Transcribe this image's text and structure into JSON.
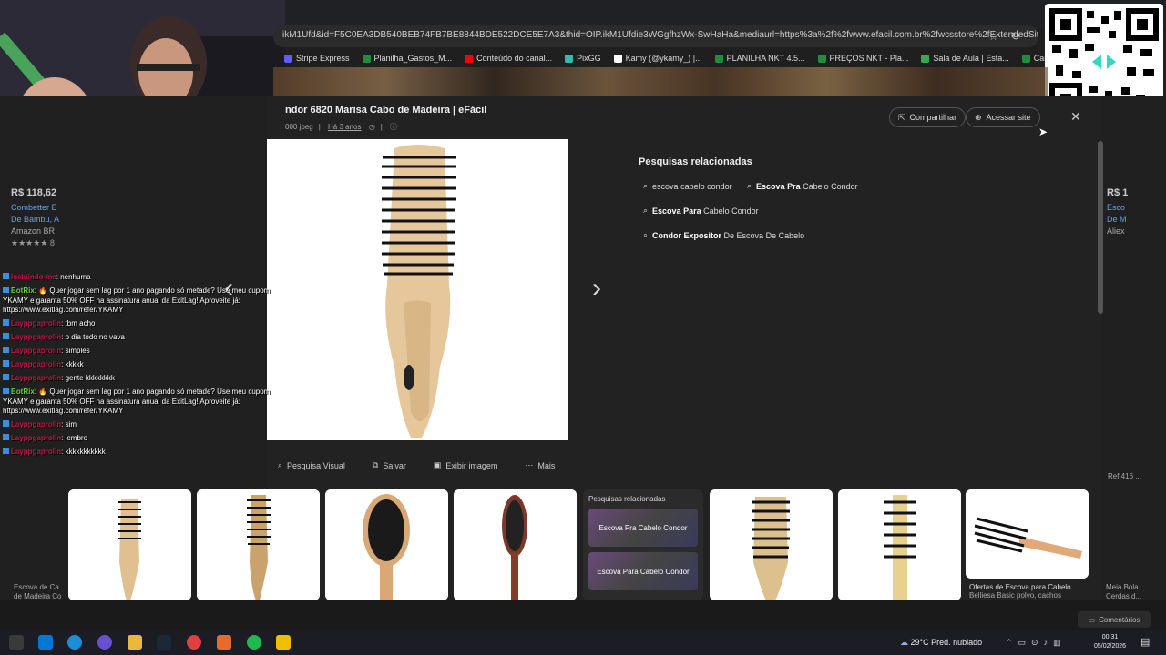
{
  "browser": {
    "url": "ikM1Ufd&id=F5C0EA3DB540BEB74FB7BE8844BDE522DCE5E7A3&thid=OIP.ikM1Ufdie3WGgfhzWx-SwHaHa&mediaurl=https%3a%2f%2fwww.efacil.com.br%2fwcsstore%2fExtendedSit...",
    "bookmarks": [
      {
        "label": "Stripe Express",
        "color": "#635bff"
      },
      {
        "label": "Planilha_Gastos_M...",
        "color": "#1e8e3e"
      },
      {
        "label": "Conteúdo do canal...",
        "color": "#ff0000"
      },
      {
        "label": "PixGG",
        "color": "#32bcad"
      },
      {
        "label": "Kamy (@ykamy_) |...",
        "color": "#ffffff"
      },
      {
        "label": "PLANILHA NKT 4.5...",
        "color": "#1e8e3e"
      },
      {
        "label": "PREÇOS NKT - Pla...",
        "color": "#1e8e3e"
      },
      {
        "label": "Sala de Aula | Esta...",
        "color": "#34a853"
      },
      {
        "label": "Cargos Ninjas - Pla...",
        "color": "#1e8e3e"
      }
    ]
  },
  "panel": {
    "title": "ndor 6820 Marisa Cabo de Madeira | eFácil",
    "meta_size": "000 jpeg",
    "meta_time": "Há 3 anos",
    "share_label": "Compartilhar",
    "visit_label": "Acessar site",
    "related_title": "Pesquisas relacionadas",
    "related": [
      {
        "pre": "",
        "bold": "",
        "post": "escova cabelo condor"
      },
      {
        "pre": "",
        "bold": "Escova Pra",
        "post": " Cabelo Condor"
      },
      {
        "pre": "",
        "bold": "Escova Para",
        "post": " Cabelo Condor"
      },
      {
        "pre": "",
        "bold": "Condor Expositor",
        "post": " De Escova De Cabelo"
      }
    ],
    "actions": [
      "Pesquisa Visual",
      "Salvar",
      "Exibir imagem",
      "Mais"
    ]
  },
  "left_card": {
    "price": "R$ 118,62",
    "line1": "Combetter E",
    "line2": "De Bambu, A",
    "store": "Amazon BR",
    "rating": "★★★★★ 8"
  },
  "right_card": {
    "price": "R$ 1",
    "line1": "Esco",
    "line2": "De M",
    "store": "Aliex"
  },
  "thumbs": {
    "related_title": "Pesquisas relacionadas",
    "related_1": "Escova Pra Cabelo Condor",
    "related_2": "Escova Para Cabelo Condor",
    "caption_1": "Ofertas de Escova para Cabelo",
    "caption_2": "Belliesa Basic polvo, cachos",
    "left_caption_1": "Escova de Ca",
    "left_caption_2": "de Madeira Co",
    "right_caption_1": "Meia Bola",
    "right_caption_2": "Cerdas d...",
    "right_ref": "Ref 416 ..."
  },
  "chat": [
    {
      "user": "Incluindo-me",
      "msg": ": nenhuma",
      "bot": false
    },
    {
      "user": "BotRix",
      "msg": ": 🔥 Quer jogar sem lag por 1 ano pagando só metade? Use meu cupom YKAMY e garanta 50% OFF na assinatura anual da ExitLag! Aproveite já: https://www.exitlag.com/refer/YKAMY",
      "bot": true
    },
    {
      "user": "Layppgaprolin",
      "msg": ": tbm acho",
      "bot": false
    },
    {
      "user": "Layppgaprolin",
      "msg": ": o dia todo no vava",
      "bot": false
    },
    {
      "user": "Layppgaprolin",
      "msg": ": simples",
      "bot": false
    },
    {
      "user": "Layppgaprolin",
      "msg": ": kkkkk",
      "bot": false
    },
    {
      "user": "Layppgaprolin",
      "msg": ": gente kkkkkkkk",
      "bot": false
    },
    {
      "user": "BotRix",
      "msg": ": 🔥 Quer jogar sem lag por 1 ano pagando só metade? Use meu cupom YKAMY e garanta 50% OFF na assinatura anual da ExitLag! Aproveite já: https://www.exitlag.com/refer/YKAMY",
      "bot": true
    },
    {
      "user": "Layppgaprolin",
      "msg": ": sim",
      "bot": false
    },
    {
      "user": "Layppgaprolin",
      "msg": ": lembro",
      "bot": false
    },
    {
      "user": "Layppgaprolin",
      "msg": ": kkkkkkkkkkk",
      "bot": false
    }
  ],
  "taskbar": {
    "weather": "29°C  Pred. nublado",
    "time": "00:31",
    "date": "05/02/2026",
    "comments": "Comentários"
  }
}
